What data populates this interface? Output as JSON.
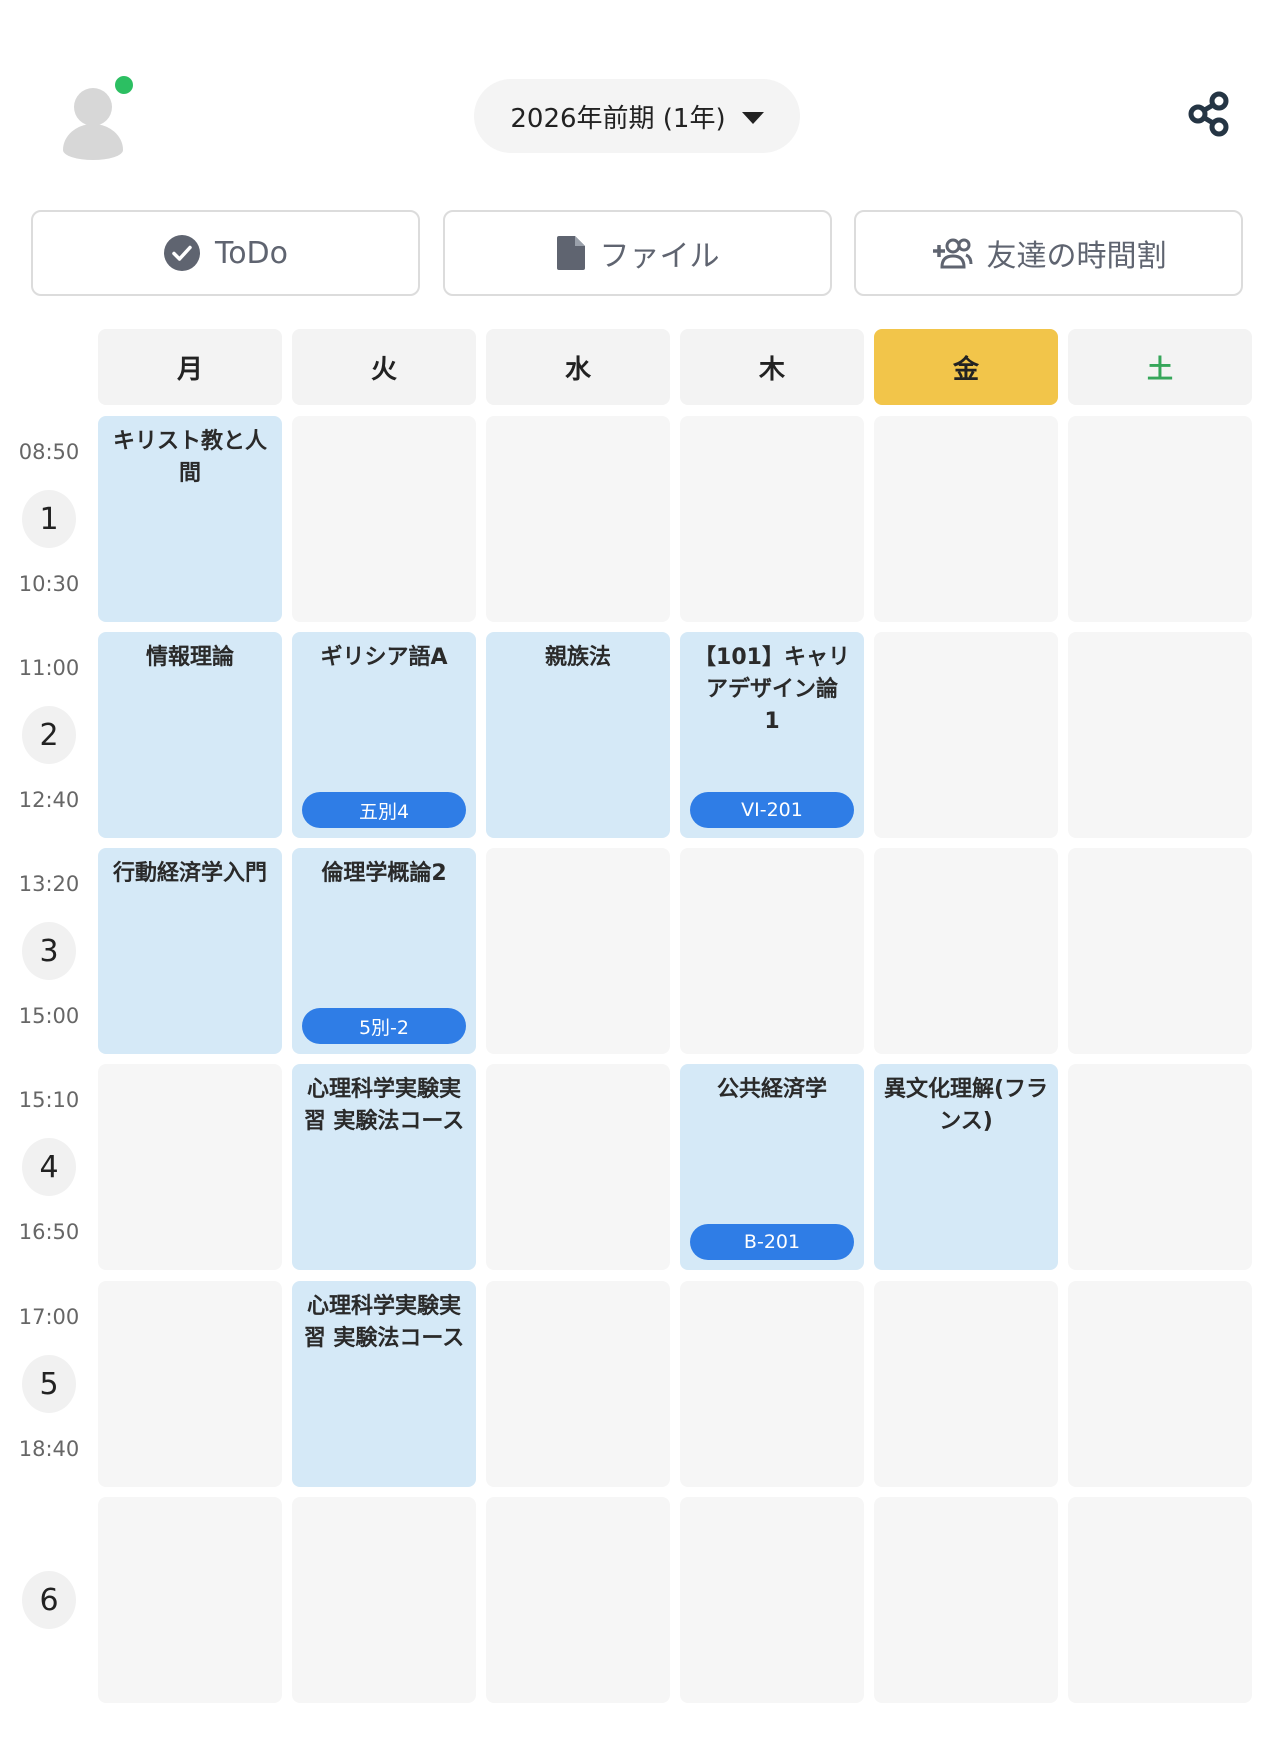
{
  "header": {
    "term_label": "2026年前期 (1年)"
  },
  "actions": {
    "todo_label": "ToDo",
    "file_label": "ファイル",
    "friends_label": "友達の時間割"
  },
  "days": [
    "月",
    "火",
    "水",
    "木",
    "金",
    "土"
  ],
  "active_day": "金",
  "periods": [
    {
      "number": "1",
      "start": "08:50",
      "end": "10:30"
    },
    {
      "number": "2",
      "start": "11:00",
      "end": "12:40"
    },
    {
      "number": "3",
      "start": "13:20",
      "end": "15:00"
    },
    {
      "number": "4",
      "start": "15:10",
      "end": "16:50"
    },
    {
      "number": "5",
      "start": "17:00",
      "end": "18:40"
    },
    {
      "number": "6",
      "start": "",
      "end": ""
    }
  ],
  "timetable": [
    [
      {
        "name": "キリスト教と人間",
        "room": ""
      },
      {
        "name": "",
        "room": ""
      },
      {
        "name": "",
        "room": ""
      },
      {
        "name": "",
        "room": ""
      },
      {
        "name": "",
        "room": ""
      },
      {
        "name": "",
        "room": ""
      }
    ],
    [
      {
        "name": "情報理論",
        "room": ""
      },
      {
        "name": "ギリシア語A",
        "room": "五別4"
      },
      {
        "name": "親族法",
        "room": ""
      },
      {
        "name": "【101】キャリアデザイン論　1",
        "room": "VI-201"
      },
      {
        "name": "",
        "room": ""
      },
      {
        "name": "",
        "room": ""
      }
    ],
    [
      {
        "name": "行動経済学入門",
        "room": ""
      },
      {
        "name": "倫理学概論2",
        "room": "5別-2"
      },
      {
        "name": "",
        "room": ""
      },
      {
        "name": "",
        "room": ""
      },
      {
        "name": "",
        "room": ""
      },
      {
        "name": "",
        "room": ""
      }
    ],
    [
      {
        "name": "",
        "room": ""
      },
      {
        "name": "心理科学実験実習 実験法コース",
        "room": ""
      },
      {
        "name": "",
        "room": ""
      },
      {
        "name": "公共経済学",
        "room": "B-201"
      },
      {
        "name": "異文化理解(フランス)",
        "room": ""
      },
      {
        "name": "",
        "room": ""
      }
    ],
    [
      {
        "name": "",
        "room": ""
      },
      {
        "name": "心理科学実験実習 実験法コース",
        "room": ""
      },
      {
        "name": "",
        "room": ""
      },
      {
        "name": "",
        "room": ""
      },
      {
        "name": "",
        "room": ""
      },
      {
        "name": "",
        "room": ""
      }
    ],
    [
      {
        "name": "",
        "room": ""
      },
      {
        "name": "",
        "room": ""
      },
      {
        "name": "",
        "room": ""
      },
      {
        "name": "",
        "room": ""
      },
      {
        "name": "",
        "room": ""
      },
      {
        "name": "",
        "room": ""
      }
    ]
  ],
  "colors": {
    "active_day": "#f2c54a",
    "saturday_text": "#36a65a",
    "class_cell": "#d5e9f7",
    "empty_cell": "#f6f6f6",
    "room_badge": "#2f7de6",
    "online_dot": "#2cbf62"
  },
  "icons": {
    "avatar": "user-silhouette-icon",
    "share": "share-icon",
    "todo": "check-circle-icon",
    "file": "file-icon",
    "friends": "add-friend-icon",
    "term_dropdown": "caret-down-icon"
  }
}
